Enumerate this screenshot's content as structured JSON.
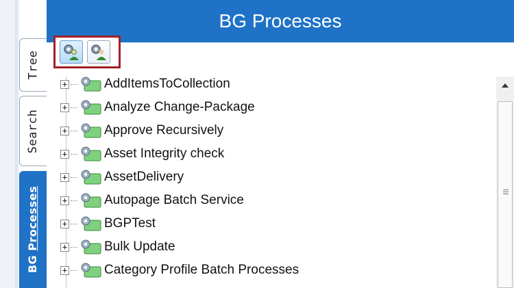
{
  "header": {
    "title": "BG Processes"
  },
  "side_tabs": [
    {
      "label": "Tree"
    },
    {
      "label": "Search"
    },
    {
      "label": "BG Processes",
      "underlined_part": "Processes"
    }
  ],
  "toolbar": {
    "buttons": [
      {
        "icon": "processes-view-icon",
        "active": true
      },
      {
        "icon": "processes-alt-view-icon",
        "active": false
      }
    ],
    "highlight_color": "#a31f27"
  },
  "tree": {
    "items": [
      {
        "label": "AddItemsToCollection",
        "expander": "+"
      },
      {
        "label": "Analyze Change-Package",
        "expander": "+"
      },
      {
        "label": "Approve Recursively",
        "expander": "+"
      },
      {
        "label": "Asset Integrity check",
        "expander": "+"
      },
      {
        "label": "AssetDelivery",
        "expander": "+"
      },
      {
        "label": "Autopage Batch Service",
        "expander": "+"
      },
      {
        "label": "BGPTest",
        "expander": "+"
      },
      {
        "label": "Bulk Update",
        "expander": "+"
      },
      {
        "label": "Category Profile Batch Processes",
        "expander": "+"
      }
    ]
  },
  "colors": {
    "accent": "#1f72c6"
  }
}
